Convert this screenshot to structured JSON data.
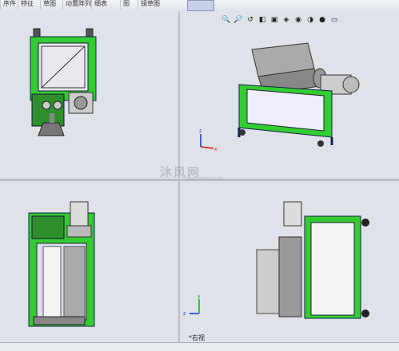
{
  "toolbar": {
    "items": [
      "序件",
      "特征",
      "草图",
      "动置阵列",
      "细表",
      "图",
      "镜草图"
    ]
  },
  "heads_up_toolbar": {
    "icons": [
      "zoom-to-fit-icon",
      "zoom-area-icon",
      "previous-view-icon",
      "section-view-icon",
      "view-orientation-icon",
      "display-style-icon",
      "hide-show-icon",
      "edit-appearance-icon",
      "scenes-icon",
      "view-settings-icon"
    ]
  },
  "watermark": {
    "text": "沐风网",
    "subtext": "WWW.MFCAD.COM"
  },
  "viewports": {
    "bottom_right_label": "*右视"
  },
  "colors": {
    "frame_green": "#33cc33",
    "viewport_bg": "#dfe2e8",
    "axis_x": "#dd1111",
    "axis_y": "#11aa11",
    "axis_z": "#1133cc"
  }
}
